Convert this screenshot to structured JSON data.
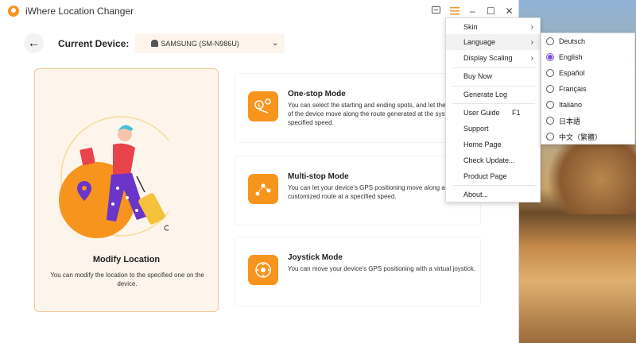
{
  "app": {
    "title": "iWhere Location Changer",
    "window_controls": {
      "feedback_icon": "feedback-icon",
      "menu_icon": "hamburger-icon",
      "minimize": "–",
      "maximize": "☐",
      "close": "✕"
    }
  },
  "header": {
    "back_icon": "←",
    "current_device_label": "Current Device:",
    "device_name": "SAMSUNG (SM-N986U)",
    "dropdown_icon": "⌄"
  },
  "modify_card": {
    "title": "Modify Location",
    "description": "You can modify the location to the specified one on the device."
  },
  "modes": [
    {
      "title": "One-stop Mode",
      "description": "You can select the starting and ending spots, and let the positioning of the device move along the route generated at the system at a specified speed."
    },
    {
      "title": "Multi-stop Mode",
      "description": "You can let your device's GPS positioning move along a customized route at a specified speed."
    },
    {
      "title": "Joystick Mode",
      "description": "You can move your device's GPS positioning with a virtual joystick."
    }
  ],
  "menu": {
    "items": [
      {
        "label": "Skin",
        "arrow": "›"
      },
      {
        "label": "Language",
        "arrow": "›"
      },
      {
        "label": "Display Scaling",
        "arrow": "›"
      },
      {
        "label": "Buy Now"
      },
      {
        "label": "Generate Log"
      },
      {
        "label": "User Guide",
        "shortcut": "F1"
      },
      {
        "label": "Support"
      },
      {
        "label": "Home Page"
      },
      {
        "label": "Check Update..."
      },
      {
        "label": "Product Page"
      },
      {
        "label": "About..."
      }
    ]
  },
  "language_menu": {
    "selected": "English",
    "items": [
      "Deutsch",
      "English",
      "Español",
      "Français",
      "Italiano",
      "日本語",
      "中文（繁體）"
    ]
  },
  "colors": {
    "accent": "#f7941d",
    "card_bg": "#fdf5ec",
    "radio_selected": "#7a4ed8"
  }
}
